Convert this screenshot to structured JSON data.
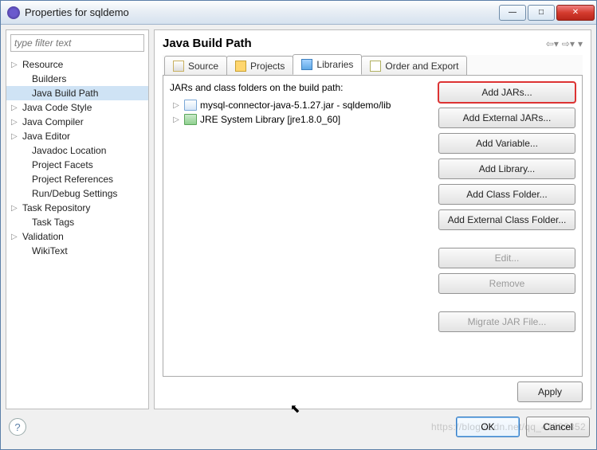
{
  "window": {
    "title": "Properties for sqldemo"
  },
  "filter": {
    "placeholder": "type filter text"
  },
  "sidebar": {
    "items": [
      {
        "label": "Resource",
        "expandable": true,
        "indent": false,
        "selected": false
      },
      {
        "label": "Builders",
        "expandable": false,
        "indent": true,
        "selected": false
      },
      {
        "label": "Java Build Path",
        "expandable": false,
        "indent": true,
        "selected": true
      },
      {
        "label": "Java Code Style",
        "expandable": true,
        "indent": false,
        "selected": false
      },
      {
        "label": "Java Compiler",
        "expandable": true,
        "indent": false,
        "selected": false
      },
      {
        "label": "Java Editor",
        "expandable": true,
        "indent": false,
        "selected": false
      },
      {
        "label": "Javadoc Location",
        "expandable": false,
        "indent": true,
        "selected": false
      },
      {
        "label": "Project Facets",
        "expandable": false,
        "indent": true,
        "selected": false
      },
      {
        "label": "Project References",
        "expandable": false,
        "indent": true,
        "selected": false
      },
      {
        "label": "Run/Debug Settings",
        "expandable": false,
        "indent": true,
        "selected": false
      },
      {
        "label": "Task Repository",
        "expandable": true,
        "indent": false,
        "selected": false
      },
      {
        "label": "Task Tags",
        "expandable": false,
        "indent": true,
        "selected": false
      },
      {
        "label": "Validation",
        "expandable": true,
        "indent": false,
        "selected": false
      },
      {
        "label": "WikiText",
        "expandable": false,
        "indent": true,
        "selected": false
      }
    ]
  },
  "main": {
    "title": "Java Build Path",
    "tabs": [
      {
        "label": "Source",
        "icon": "source-icon"
      },
      {
        "label": "Projects",
        "icon": "projects-icon"
      },
      {
        "label": "Libraries",
        "icon": "libraries-icon"
      },
      {
        "label": "Order and Export",
        "icon": "order-icon"
      }
    ],
    "active_tab": 2,
    "list_caption": "JARs and class folders on the build path:",
    "jars": [
      {
        "label": "mysql-connector-java-5.1.27.jar - sqldemo/lib",
        "icon": "jar-icon"
      },
      {
        "label": "JRE System Library [jre1.8.0_60]",
        "icon": "jre-icon"
      }
    ],
    "buttons": [
      {
        "label": "Add JARs...",
        "state": "highlight"
      },
      {
        "label": "Add External JARs...",
        "state": "normal"
      },
      {
        "label": "Add Variable...",
        "state": "normal"
      },
      {
        "label": "Add Library...",
        "state": "normal"
      },
      {
        "label": "Add Class Folder...",
        "state": "normal"
      },
      {
        "label": "Add External Class Folder...",
        "state": "normal"
      },
      {
        "label": "Edit...",
        "state": "disabled"
      },
      {
        "label": "Remove",
        "state": "disabled"
      },
      {
        "label": "Migrate JAR File...",
        "state": "disabled"
      }
    ],
    "apply_label": "Apply"
  },
  "dialog": {
    "ok": "OK",
    "cancel": "Cancel"
  },
  "watermark": "https://blog.csdn.net/qq_43592352"
}
